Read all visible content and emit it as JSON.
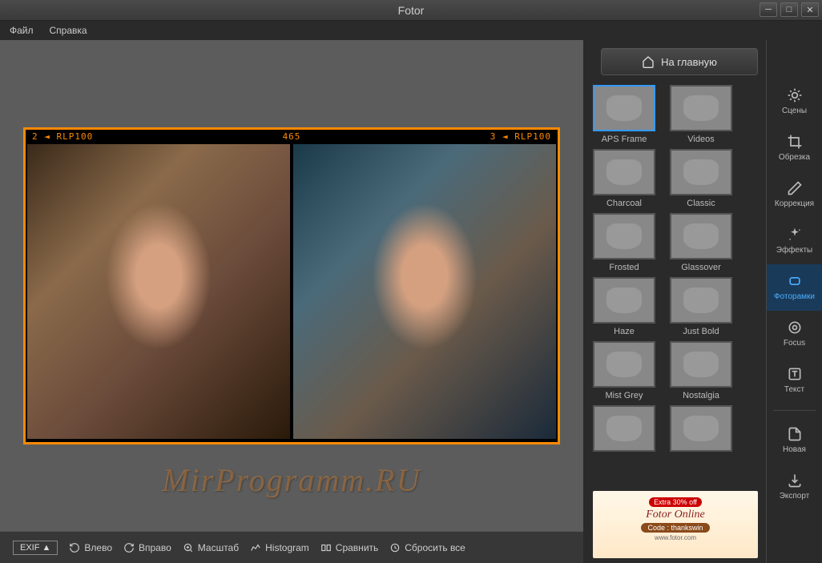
{
  "app": {
    "title": "Fotor"
  },
  "menu": {
    "file": "Файл",
    "help": "Справка"
  },
  "home_button": "На главную",
  "frame_strip": {
    "left": "2 ◄ RLP100",
    "center": "465",
    "right": "3 ◄ RLP100"
  },
  "toolbar": {
    "exif": "EXIF ▲",
    "rotate_left": "Влево",
    "rotate_right": "Вправо",
    "zoom": "Масштаб",
    "histogram": "Histogram",
    "compare": "Сравнить",
    "reset": "Сбросить все"
  },
  "frames": [
    {
      "label": "APS Frame",
      "selected": true
    },
    {
      "label": "Videos"
    },
    {
      "label": "Charcoal"
    },
    {
      "label": "Classic"
    },
    {
      "label": "Frosted"
    },
    {
      "label": "Glassover"
    },
    {
      "label": "Haze"
    },
    {
      "label": "Just Bold"
    },
    {
      "label": "Mist Grey"
    },
    {
      "label": "Nostalgia"
    },
    {
      "label": ""
    },
    {
      "label": ""
    }
  ],
  "side_tools": {
    "scenes": "Сцены",
    "crop": "Обрезка",
    "correction": "Коррекция",
    "effects": "Эффекты",
    "frames": "Фоторамки",
    "focus": "Focus",
    "text": "Текст",
    "new": "Новая",
    "export": "Экспорт"
  },
  "promo": {
    "badge": "Extra 30% off",
    "title": "Fotor Online",
    "code": "Code : thankswin",
    "url": "www.fotor.com"
  },
  "watermark": "MirProgramm.RU"
}
